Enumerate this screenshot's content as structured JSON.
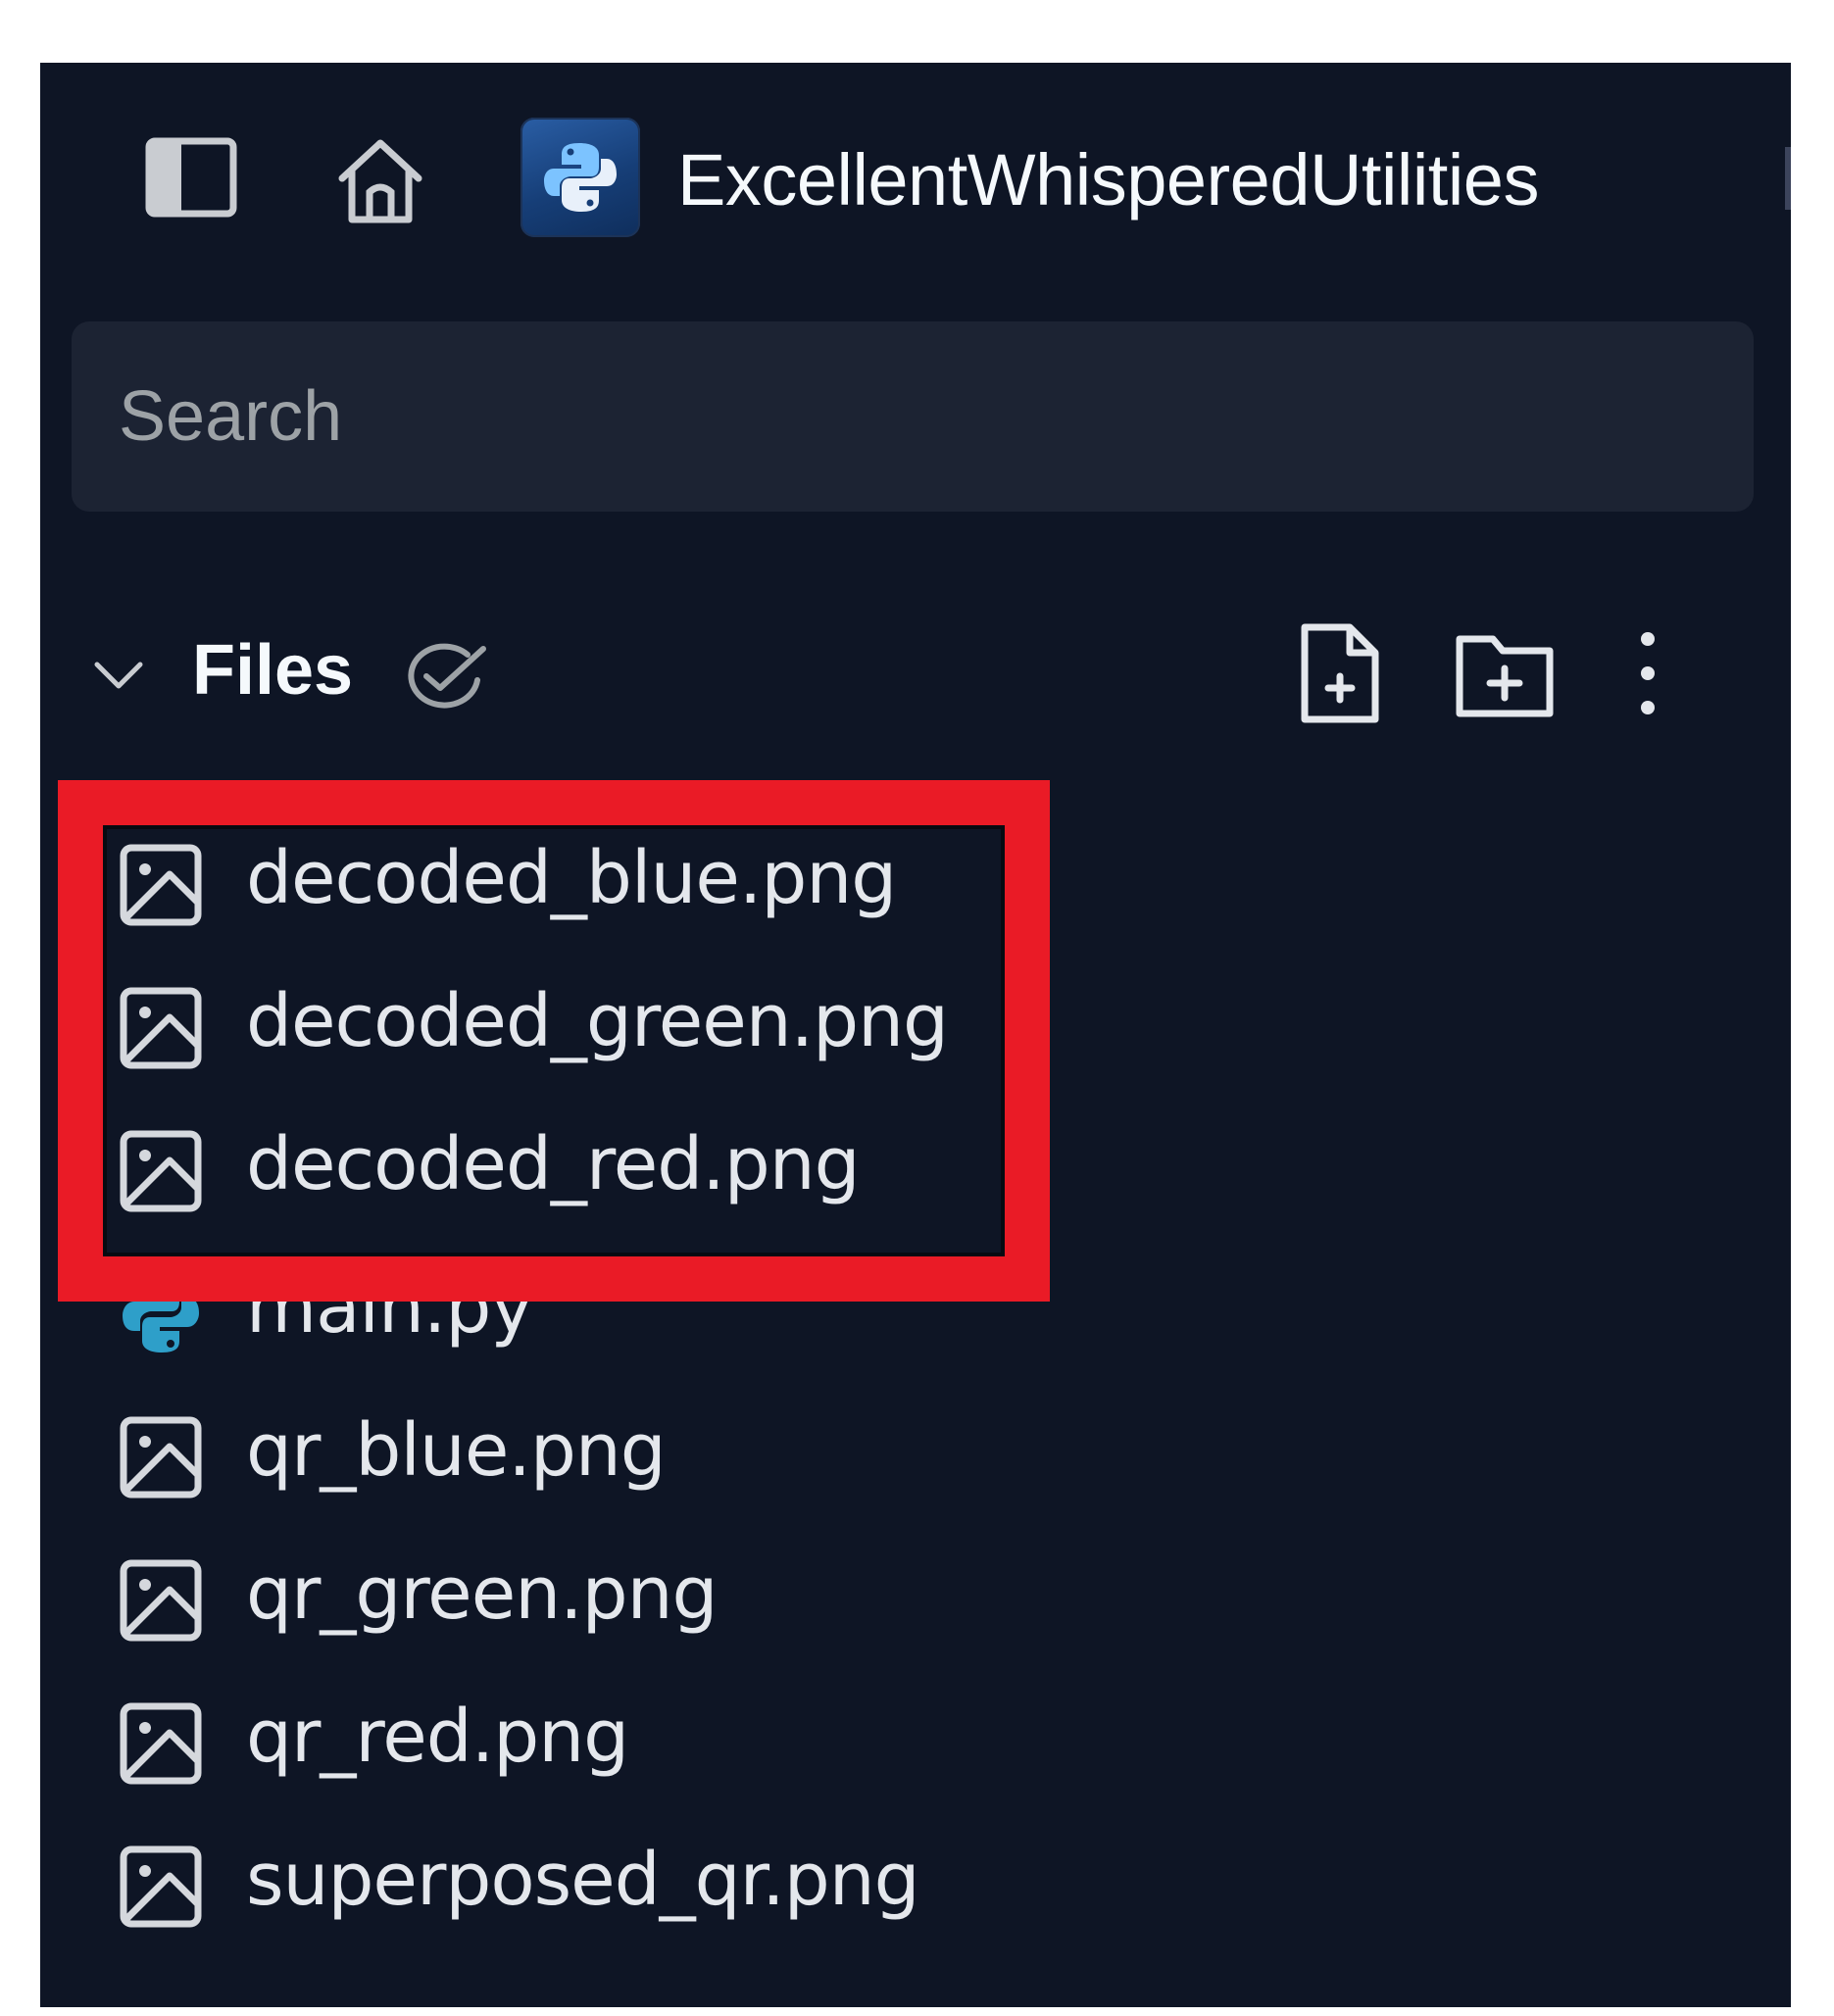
{
  "repl": {
    "name": "ExcellentWhisperedUtilities",
    "icon": "python-logo-icon"
  },
  "header": {
    "sidebar_toggle_icon": "sidebar-toggle-icon",
    "home_icon": "home-icon"
  },
  "search": {
    "placeholder": "Search",
    "value": ""
  },
  "files_panel": {
    "title": "Files",
    "status_icon": "sync-check-icon",
    "actions": {
      "new_file_icon": "new-file-icon",
      "new_folder_icon": "new-folder-icon",
      "more_icon": "more-vertical-icon"
    }
  },
  "files": [
    {
      "name": "decoded_blue.png",
      "type": "image",
      "icon": "image-file-icon"
    },
    {
      "name": "decoded_green.png",
      "type": "image",
      "icon": "image-file-icon"
    },
    {
      "name": "decoded_red.png",
      "type": "image",
      "icon": "image-file-icon"
    },
    {
      "name": "main.py",
      "type": "python",
      "icon": "python-file-icon"
    },
    {
      "name": "qr_blue.png",
      "type": "image",
      "icon": "image-file-icon"
    },
    {
      "name": "qr_green.png",
      "type": "image",
      "icon": "image-file-icon"
    },
    {
      "name": "qr_red.png",
      "type": "image",
      "icon": "image-file-icon"
    },
    {
      "name": "superposed_qr.png",
      "type": "image",
      "icon": "image-file-icon"
    }
  ],
  "annotation": {
    "highlighted_files": [
      "decoded_blue.png",
      "decoded_green.png",
      "decoded_red.png"
    ],
    "color": "#ea1b26"
  },
  "colors": {
    "panel_bg": "#0e1525",
    "search_bg": "#1c2333",
    "text": "#f5f9fc",
    "muted": "#9da2a6",
    "python_blue": "#2e9fc9"
  }
}
